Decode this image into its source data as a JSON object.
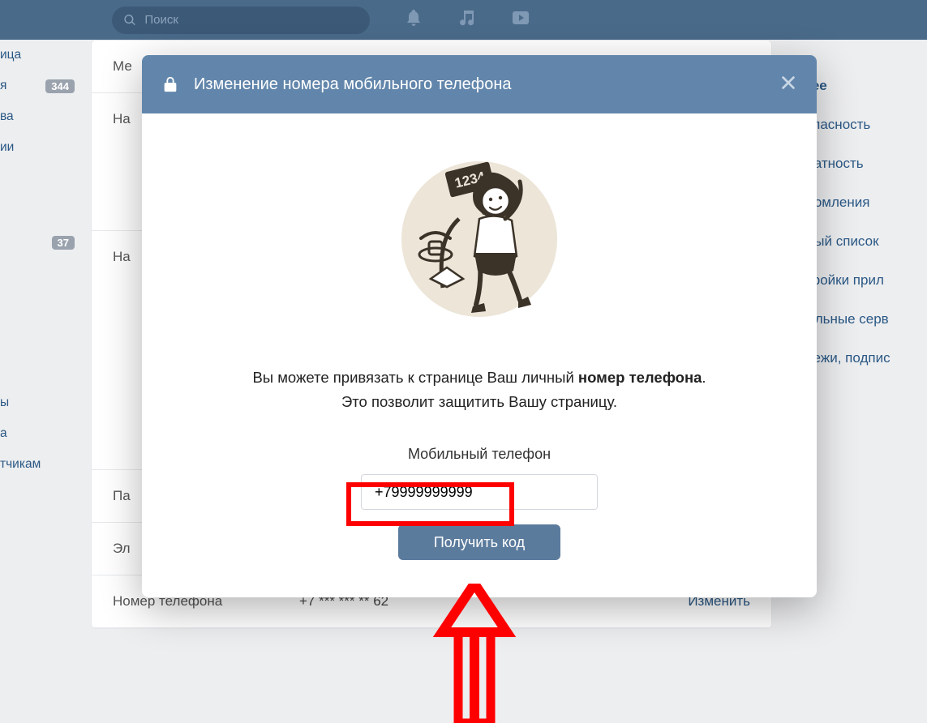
{
  "topnav": {
    "search_placeholder": "Поиск"
  },
  "left_nav": {
    "items": [
      {
        "label": "ица",
        "badge": ""
      },
      {
        "label": "я",
        "badge": "344"
      },
      {
        "label": "ва",
        "badge": ""
      },
      {
        "label": "ии",
        "badge": ""
      },
      {
        "label": "",
        "badge": "37"
      },
      {
        "label": "ы",
        "badge": ""
      },
      {
        "label": "а",
        "badge": ""
      },
      {
        "label": "тчикам",
        "badge": ""
      }
    ]
  },
  "main_card": {
    "rows": {
      "me": "Ме",
      "na1": "На",
      "na2": "На",
      "pa": "Па",
      "el": "Эл"
    },
    "phone_label": "Номер телефона",
    "phone_value": "+7 *** *** ** 62",
    "phone_change": "Изменить"
  },
  "right_nav": {
    "items": [
      "бщее",
      "езопасность",
      "риватность",
      "ведомления",
      "ёрный список",
      "астройки прил",
      "обильные серв",
      "латежи, подпис"
    ]
  },
  "modal": {
    "title": "Изменение номера мобильного телефона",
    "text_pre": "Вы можете привязать к странице Ваш личный ",
    "text_bold": "номер телефона",
    "text_post": ".",
    "text_line2": "Это позволит защитить Вашу страницу.",
    "field_label": "Мобильный телефон",
    "phone_value": "+79999999999",
    "button": "Получить код",
    "illus_sign": "1234"
  }
}
